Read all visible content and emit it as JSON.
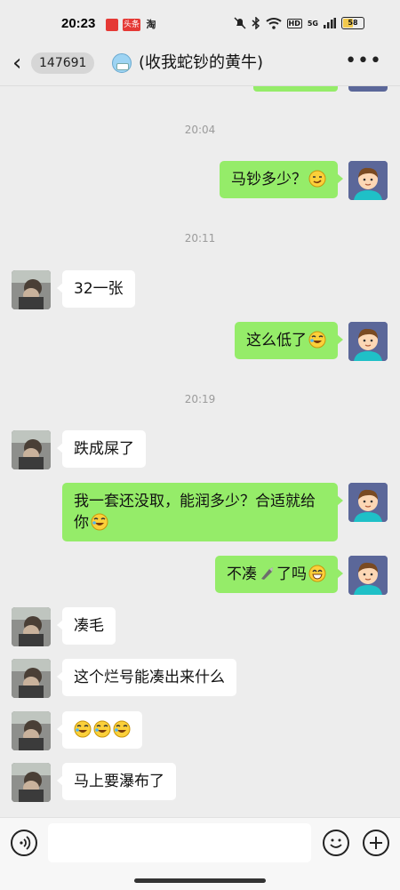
{
  "status_bar": {
    "time": "20:23",
    "app_badges": [
      "头条",
      "淘"
    ],
    "network_label": "5G",
    "hd_label": "HD",
    "battery": "58"
  },
  "header": {
    "unread_count": "147691",
    "title": "(收我蛇钞的黄牛)",
    "back_icon": "chevron-left-icon",
    "more_icon": "more-dots-icon"
  },
  "messages": [
    {
      "type": "timestamp",
      "text": "20:04"
    },
    {
      "type": "msg",
      "side": "me",
      "text": "马钞多少？",
      "emoji": [
        "smirk"
      ]
    },
    {
      "type": "timestamp",
      "text": "20:11"
    },
    {
      "type": "msg",
      "side": "other",
      "text": "32一张",
      "emoji": []
    },
    {
      "type": "msg",
      "side": "me",
      "text": "这么低了",
      "emoji": [
        "rofl"
      ]
    },
    {
      "type": "timestamp",
      "text": "20:19"
    },
    {
      "type": "msg",
      "side": "other",
      "text": "跌成屎了",
      "emoji": []
    },
    {
      "type": "msg",
      "side": "me",
      "text": "我一套还没取，能润多少？合适就给你",
      "emoji": [
        "rofl"
      ]
    },
    {
      "type": "msg",
      "side": "me",
      "text": "不凑",
      "mid_emoji": "knife",
      "text2": "了吗",
      "emoji": [
        "grin"
      ]
    },
    {
      "type": "msg",
      "side": "other",
      "text": "凑毛",
      "emoji": []
    },
    {
      "type": "msg",
      "side": "other",
      "text": "这个烂号能凑出来什么",
      "emoji": []
    },
    {
      "type": "msg",
      "side": "other",
      "text": "",
      "emoji": [
        "rofl",
        "rofl",
        "rofl"
      ]
    },
    {
      "type": "msg",
      "side": "other",
      "text": "马上要瀑布了",
      "emoji": []
    }
  ],
  "input_bar": {
    "voice_icon": "voice-icon",
    "emoji_icon": "emoji-icon",
    "plus_icon": "plus-icon",
    "placeholder": ""
  },
  "colors": {
    "bubble_me": "#95ec69",
    "bubble_other": "#ffffff",
    "background": "#ededed"
  }
}
